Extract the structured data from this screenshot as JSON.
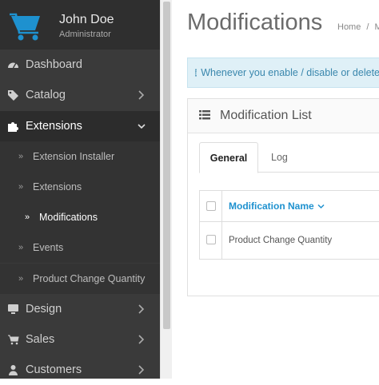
{
  "profile": {
    "name": "John Doe",
    "role": "Administrator"
  },
  "sidebar": {
    "items": [
      {
        "label": "Dashboard",
        "icon": "dashboard-icon"
      },
      {
        "label": "Catalog",
        "icon": "tag-icon"
      },
      {
        "label": "Extensions",
        "icon": "puzzle-icon"
      },
      {
        "label": "Design",
        "icon": "desktop-icon"
      },
      {
        "label": "Sales",
        "icon": "shopping-cart-icon"
      },
      {
        "label": "Customers",
        "icon": "user-icon"
      }
    ],
    "sub_items": [
      {
        "label": "Extension Installer"
      },
      {
        "label": "Extensions"
      },
      {
        "label": "Modifications"
      },
      {
        "label": "Events"
      },
      {
        "label": "Product Change Quantity"
      }
    ]
  },
  "page": {
    "title": "Modifications",
    "breadcrumb": [
      "Home",
      "/",
      "M"
    ]
  },
  "alert": {
    "text": "Whenever you enable / disable or delete a"
  },
  "panel": {
    "title": "Modification List",
    "tabs": [
      {
        "label": "General"
      },
      {
        "label": "Log"
      }
    ],
    "table": {
      "column": "Modification Name",
      "rows": [
        {
          "name": "Product Change Quantity"
        }
      ]
    }
  },
  "colors": {
    "sidebar": "#3a3a3a",
    "link": "#1e91cf",
    "alert_bg": "#dff0f7",
    "alert_text": "#3a87ad"
  }
}
